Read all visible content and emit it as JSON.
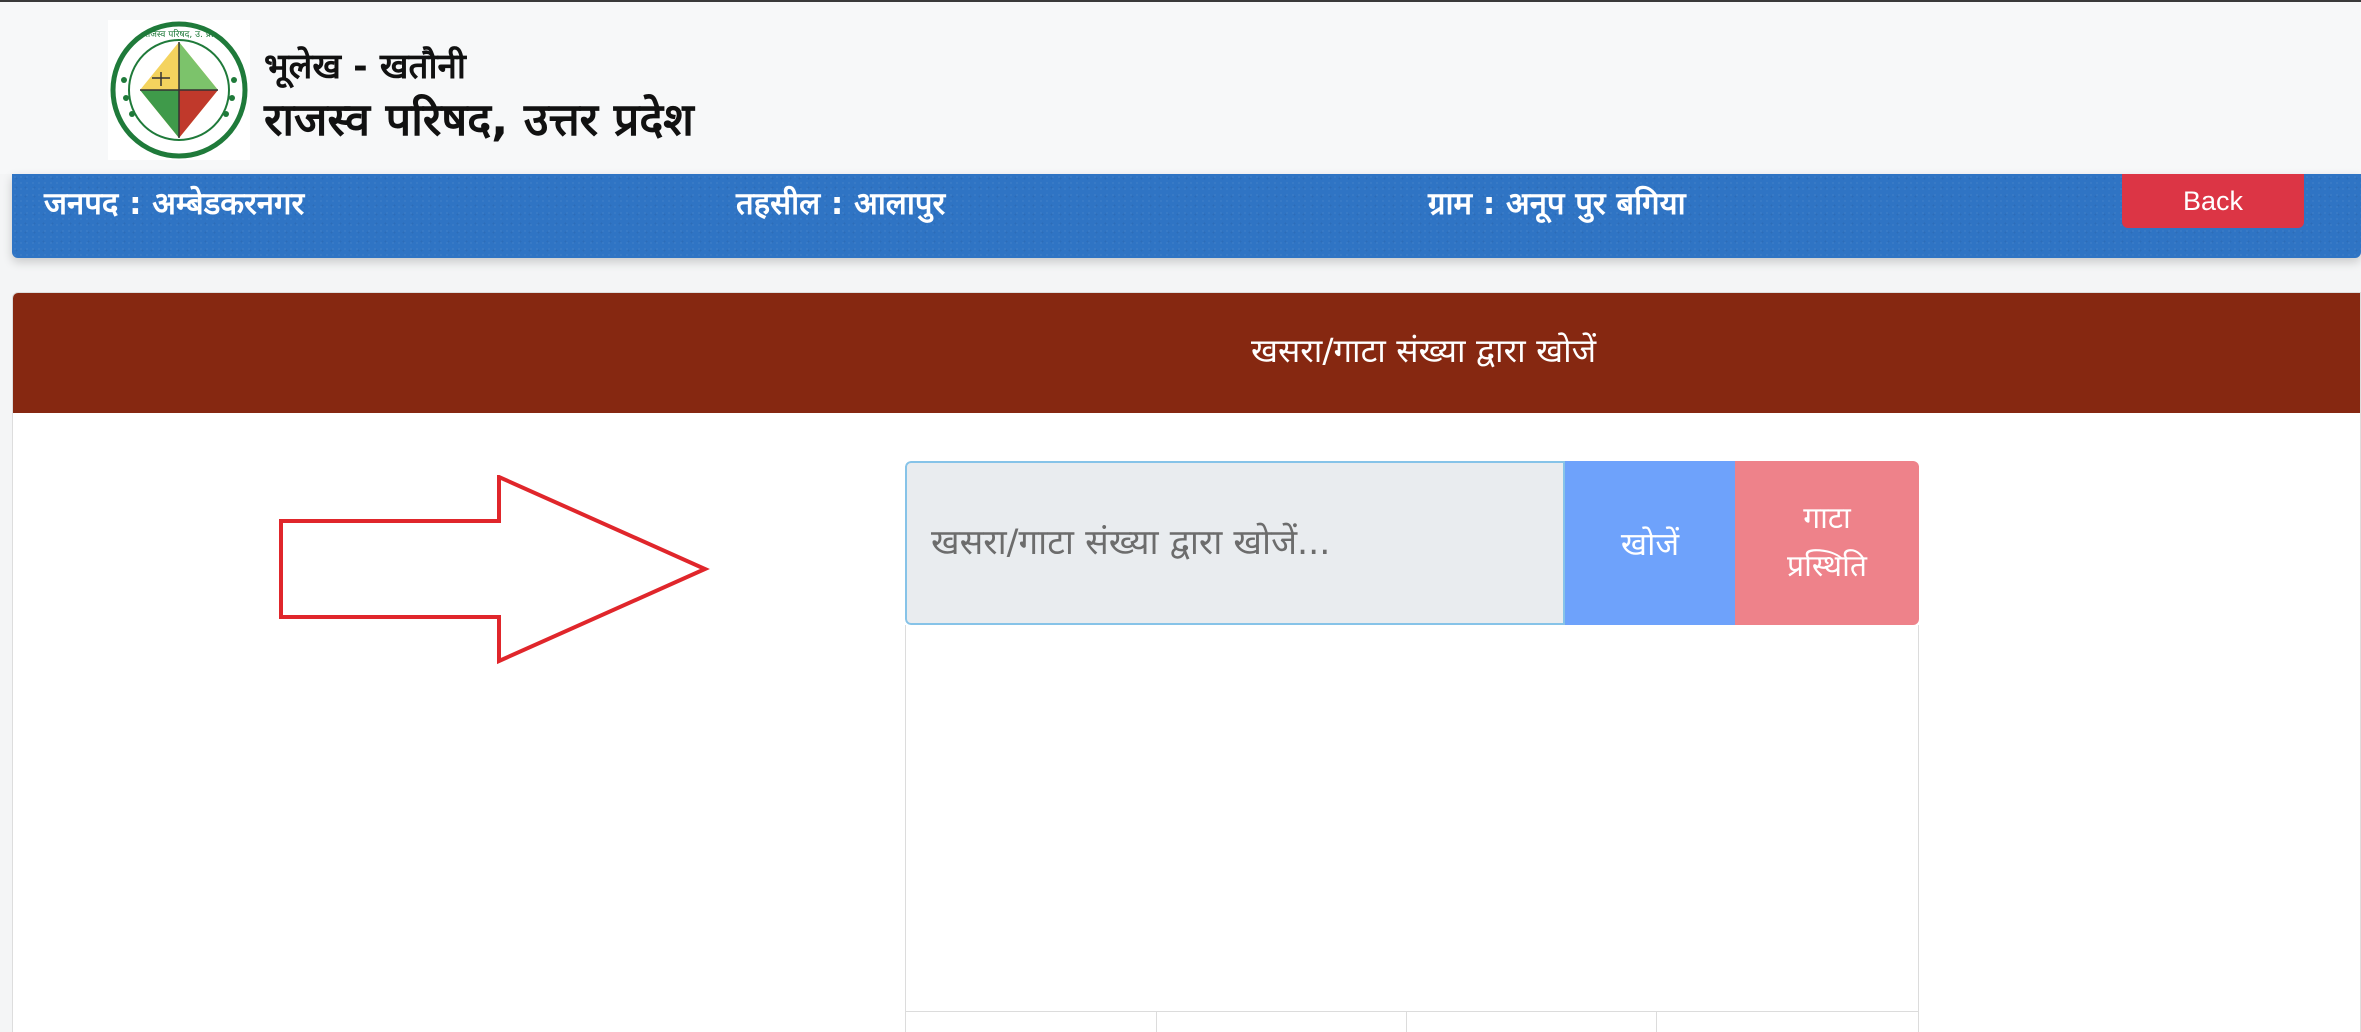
{
  "header": {
    "subtitle": "भूलेख - खतौनी",
    "title": "राजस्व परिषद, उत्तर प्रदेश",
    "logo_icon": "revenue-board-seal-icon",
    "logo_text": "राजस्व परिषद, उ. प्र."
  },
  "info_bar": {
    "district": "जनपद : अम्बेडकरनगर",
    "tehsil": "तहसील : आलापुर",
    "village": "ग्राम : अनूप पुर बगिया",
    "back_label": "Back"
  },
  "search_card": {
    "title": "खसरा/गाटा संख्या द्वारा खोजें",
    "input_placeholder": "खसरा/गाटा संख्या द्वारा खोजें...",
    "input_value": "",
    "search_label": "खोजें",
    "status_label": "गाटा\nप्रस्थिति",
    "pointer_icon": "red-arrow-right-icon"
  },
  "colors": {
    "info_bar": "#2f74c4",
    "back_button": "#dc3545",
    "card_header": "#862811",
    "search_button": "#6ea2fb",
    "status_button": "#ee828a",
    "arrow": "#e0262b"
  }
}
